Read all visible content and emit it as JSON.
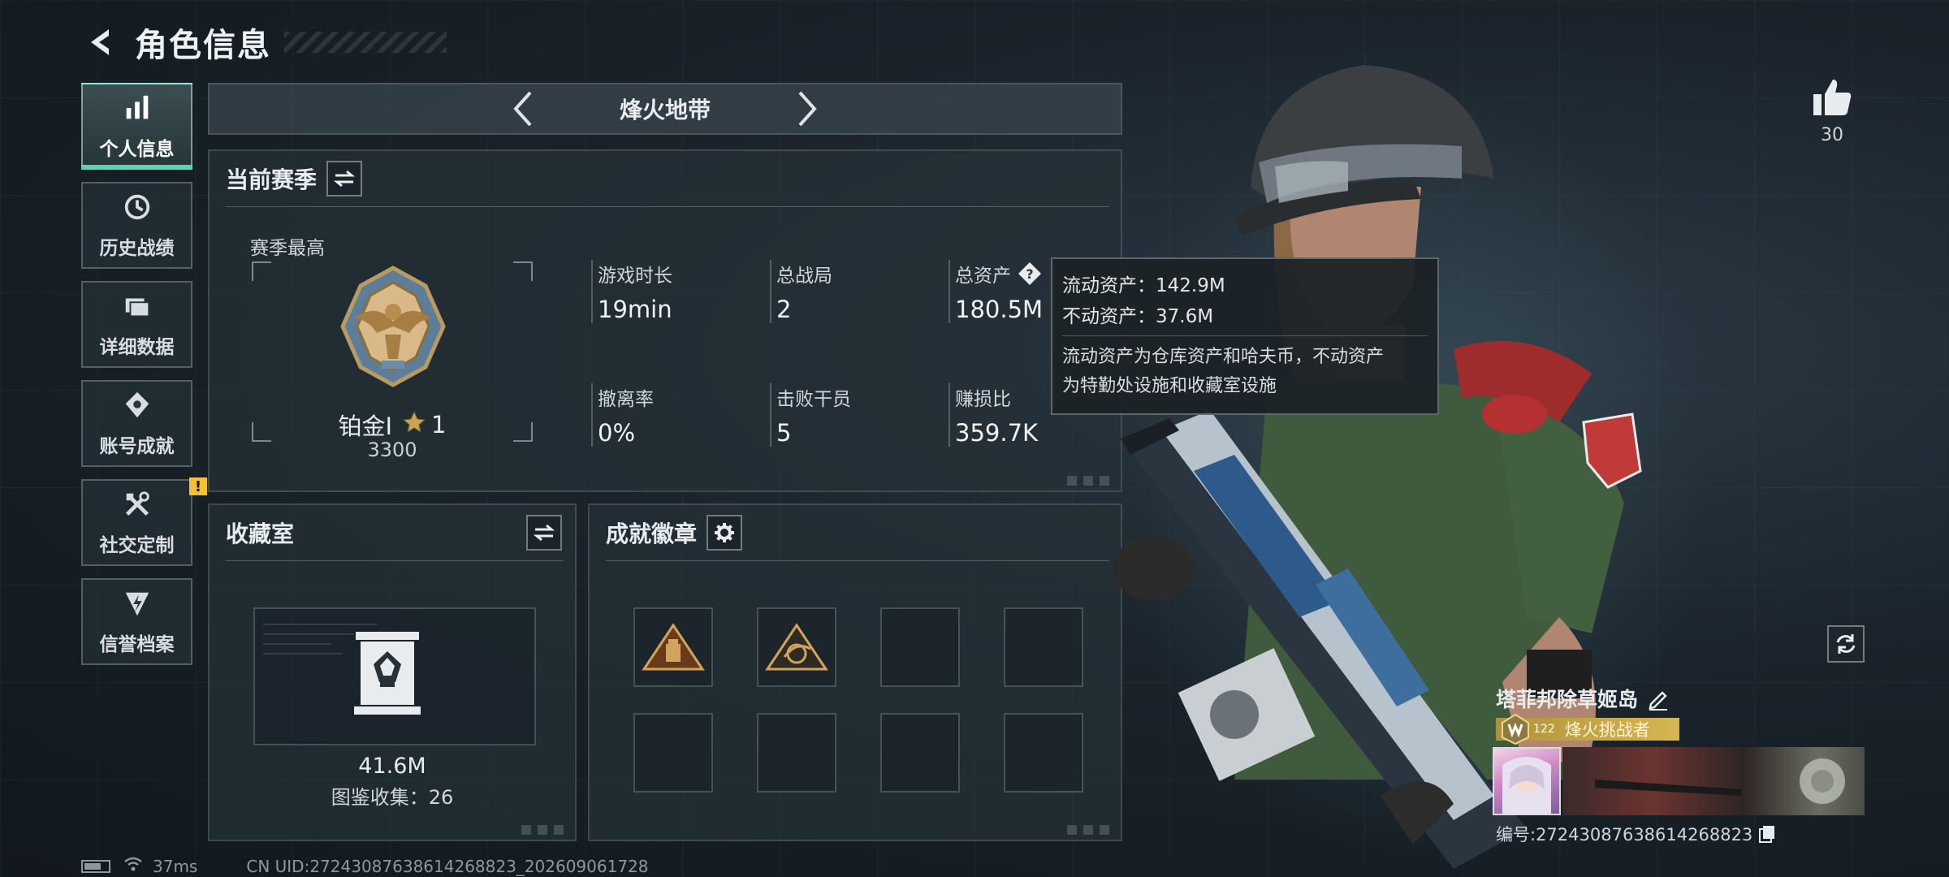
{
  "header": {
    "title": "角色信息"
  },
  "sidebar": {
    "items": [
      {
        "label": "个人信息",
        "icon": "bar-chart-icon",
        "active": true
      },
      {
        "label": "历史战绩",
        "icon": "clock-icon"
      },
      {
        "label": "详细数据",
        "icon": "folder-icon"
      },
      {
        "label": "账号成就",
        "icon": "diamond-badge-icon"
      },
      {
        "label": "社交定制",
        "icon": "tools-icon",
        "alert": "!"
      },
      {
        "label": "信誉档案",
        "icon": "lightning-badge-icon"
      }
    ]
  },
  "mode": {
    "title": "烽火地带"
  },
  "season": {
    "title": "当前赛季",
    "best_label": "赛季最高",
    "rank_name": "铂金I",
    "rank_stars": "1",
    "rank_points": "3300",
    "stats": [
      {
        "label": "游戏时长",
        "value": "19min"
      },
      {
        "label": "总战局",
        "value": "2"
      },
      {
        "label": "总资产",
        "value": "180.5M"
      },
      {
        "label": "撤离率",
        "value": "0%"
      },
      {
        "label": "击败干员",
        "value": "5"
      },
      {
        "label": "赚损比",
        "value": "359.7K"
      }
    ]
  },
  "tooltip": {
    "liquid": "流动资产：142.9M",
    "fixed": "不动资产：37.6M",
    "desc_1": "流动资产为仓库资产和哈夫币，不动资产",
    "desc_2": "为特勤处设施和收藏室设施"
  },
  "collection": {
    "title": "收藏室",
    "value": "41.6M",
    "count": "图鉴收集：26"
  },
  "badges": {
    "title": "成就徽章",
    "slots": 8,
    "filled": 2
  },
  "likes": {
    "count": "30"
  },
  "player": {
    "name": "塔菲邦除草姬岛",
    "level": "122",
    "title": "烽火挑战者",
    "id_text": "编号:27243087638614268823"
  },
  "status": {
    "ping": "37ms",
    "uid": "CN UID:27243087638614268823_202609061728"
  },
  "colors": {
    "accent": "#57d6b3",
    "gold": "#d8b650",
    "alert": "#f2c230"
  }
}
